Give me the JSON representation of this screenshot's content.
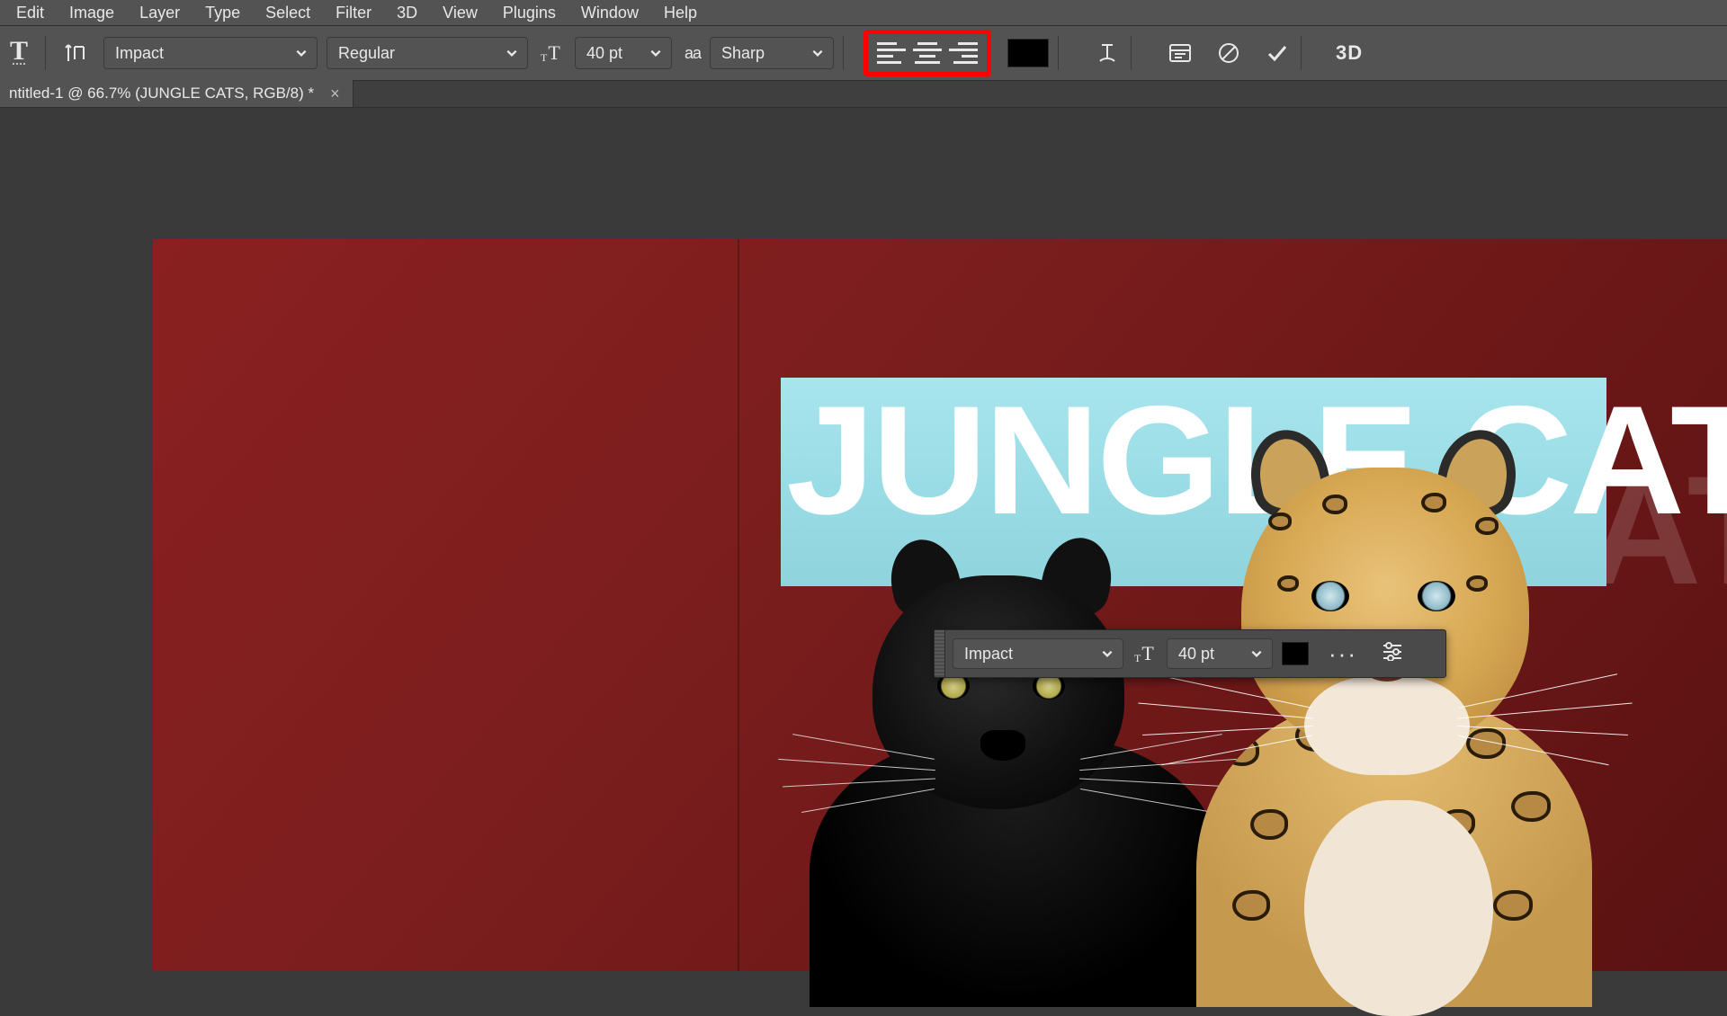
{
  "menu": {
    "items": [
      "Edit",
      "Image",
      "Layer",
      "Type",
      "Select",
      "Filter",
      "3D",
      "View",
      "Plugins",
      "Window",
      "Help"
    ]
  },
  "optionsBar": {
    "tool": "T",
    "font": "Impact",
    "fontStyle": "Regular",
    "fontSize": "40 pt",
    "antiAliasLabel": "aa",
    "antiAlias": "Sharp",
    "textColor": "#000000",
    "threeD": "3D"
  },
  "docTab": {
    "title": "ntitled-1 @ 66.7% (JUNGLE CATS, RGB/8) *",
    "close": "×"
  },
  "canvas": {
    "titleText": "JUNGLE CATS"
  },
  "floatPanel": {
    "font": "Impact",
    "fontSize": "40 pt",
    "color": "#000000",
    "more": "···"
  }
}
